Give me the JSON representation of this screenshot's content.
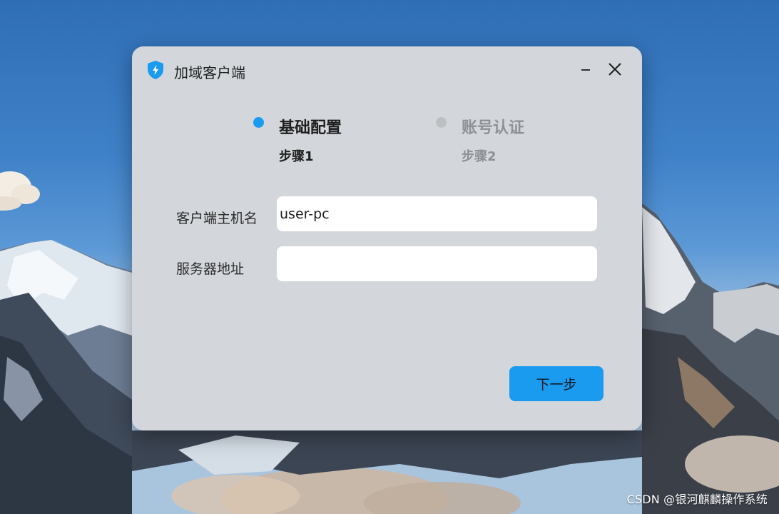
{
  "window": {
    "title": "加域客户端",
    "icon": "shield-lightning-icon",
    "minimize_icon": "minimize-icon",
    "close_icon": "close-icon"
  },
  "steps": [
    {
      "title": "基础配置",
      "subtitle": "步骤1",
      "state": "active"
    },
    {
      "title": "账号认证",
      "subtitle": "步骤2",
      "state": "inactive"
    }
  ],
  "form": {
    "hostname_label": "客户端主机名",
    "hostname_value": "user-pc",
    "server_label": "服务器地址",
    "server_value": ""
  },
  "actions": {
    "next_label": "下一步"
  },
  "watermark": "CSDN @银河麒麟操作系统",
  "colors": {
    "accent": "#1a9bf0",
    "dialog_bg": "#d3d7dc",
    "inactive_step": "#8e9094"
  }
}
